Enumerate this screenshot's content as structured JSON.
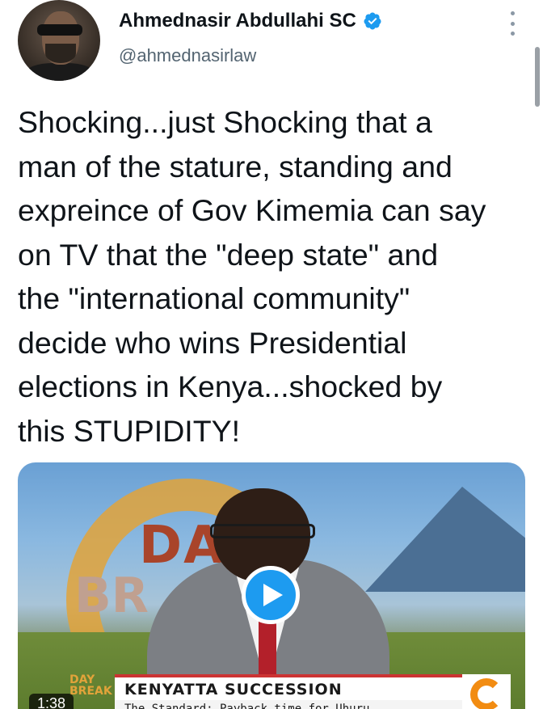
{
  "tweet": {
    "display_name": "Ahmednasir Abdullahi SC",
    "handle": "@ahmednasirlaw",
    "verified_icon": "verified-badge-icon",
    "text": "Shocking...just Shocking that a\nman of the stature, standing and\nexpreince of Gov Kimemia can say\non TV that the \"deep state\" and\nthe \"international community\"\ndecide who wins Presidential\nelections in Kenya...shocked by\nthis STUPIDITY!"
  },
  "video": {
    "duration": "1:38",
    "show_title_top": "DA",
    "show_title_bottom": "BR",
    "badge": "DAY\nBREAK",
    "lower_third_title": "KENYATTA SUCCESSION",
    "lower_third_subtitle": "The Standard: Payback time for Uhuru"
  },
  "colors": {
    "accent": "#1d9bf0",
    "text_primary": "#0f1419",
    "text_secondary": "#536471"
  }
}
